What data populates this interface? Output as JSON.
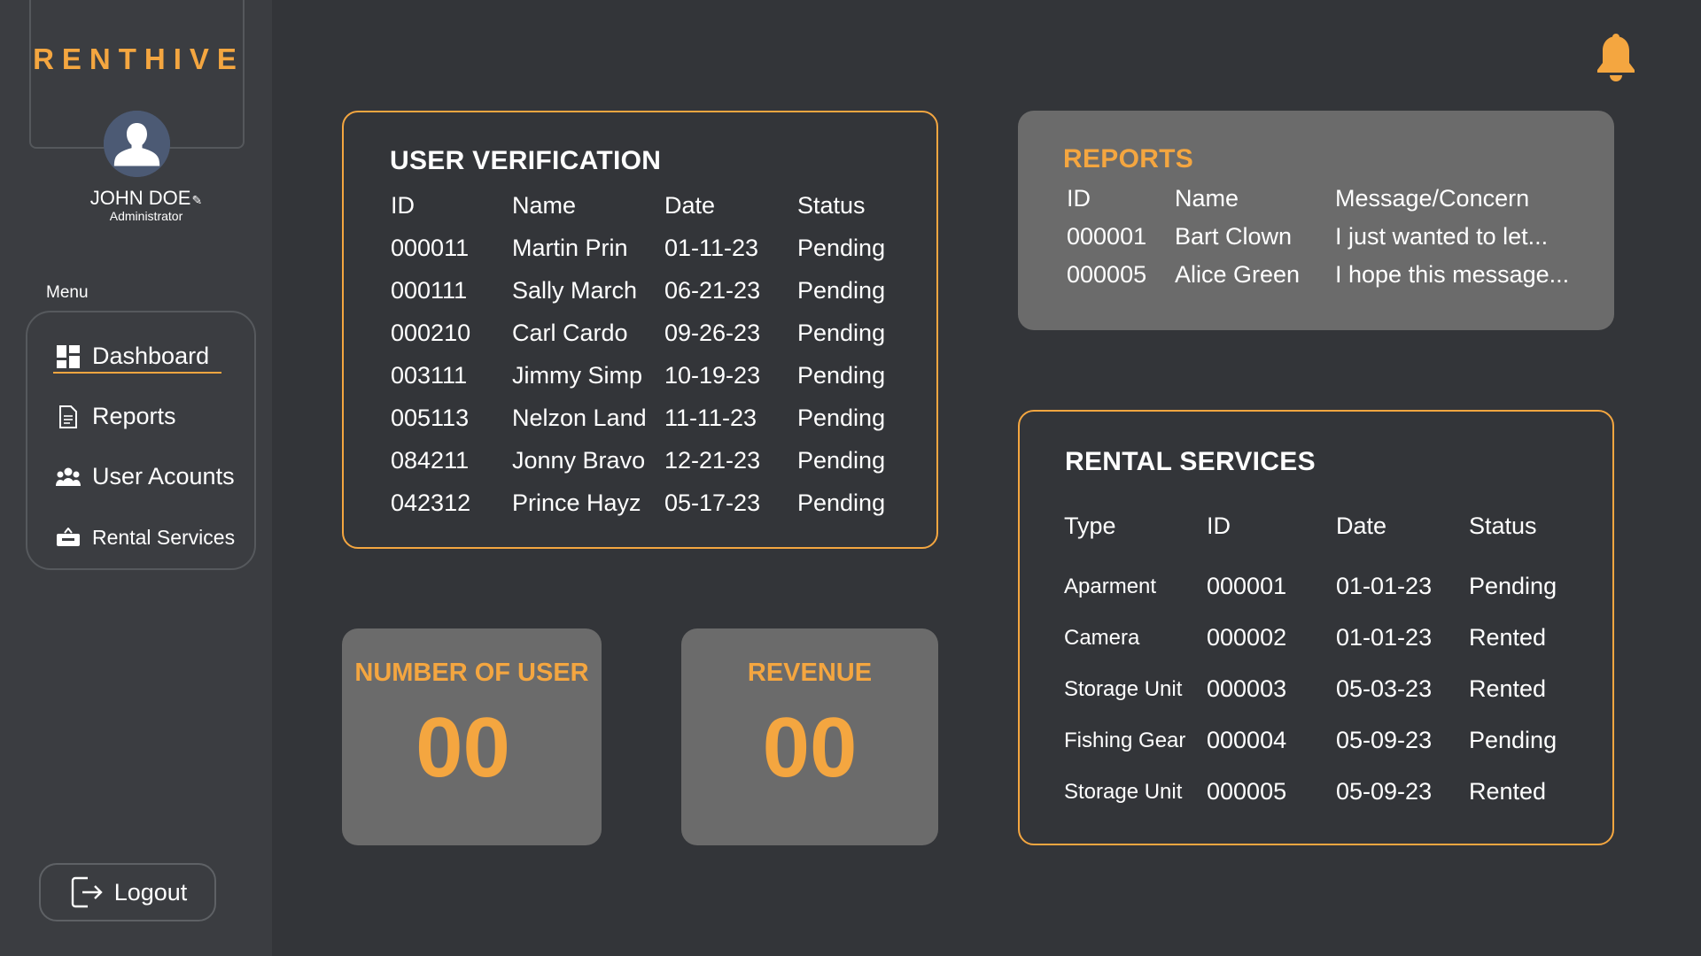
{
  "brand": {
    "name": "RENTHIVE",
    "accent": "#f4a640"
  },
  "user": {
    "name": "JOHN DOE",
    "edit_icon": "pencil-icon",
    "role": "Administrator"
  },
  "menu": {
    "label": "Menu",
    "items": [
      {
        "label": "Dashboard",
        "icon": "dashboard-icon",
        "active": true
      },
      {
        "label": "Reports",
        "icon": "document-icon"
      },
      {
        "label": "User Acounts",
        "icon": "users-icon"
      },
      {
        "label": "Rental Services",
        "icon": "rent-sign-icon"
      }
    ]
  },
  "logout": {
    "label": "Logout",
    "icon": "logout-icon"
  },
  "notifications": {
    "icon": "bell-icon"
  },
  "user_verification": {
    "title": "USER VERIFICATION",
    "columns": [
      "ID",
      "Name",
      "Date",
      "Status"
    ],
    "rows": [
      [
        "000011",
        "Martin Prin",
        "01-11-23",
        "Pending"
      ],
      [
        "000111",
        "Sally March",
        "06-21-23",
        "Pending"
      ],
      [
        "000210",
        "Carl Cardo",
        "09-26-23",
        "Pending"
      ],
      [
        "003111",
        "Jimmy Simp",
        "10-19-23",
        "Pending"
      ],
      [
        "005113",
        "Nelzon Land",
        "11-11-23",
        "Pending"
      ],
      [
        "084211",
        "Jonny Bravo",
        "12-21-23",
        "Pending"
      ],
      [
        "042312",
        "Prince Hayz",
        "05-17-23",
        "Pending"
      ]
    ]
  },
  "reports": {
    "title": "REPORTS",
    "columns": [
      "ID",
      "Name",
      "Message/Concern"
    ],
    "rows": [
      [
        "000001",
        "Bart Clown",
        "I just wanted to let..."
      ],
      [
        "000005",
        "Alice Green",
        "I hope this message..."
      ]
    ]
  },
  "stats": {
    "users": {
      "title": "NUMBER OF USER",
      "value": "00"
    },
    "revenue": {
      "title": "REVENUE",
      "value": "00"
    }
  },
  "rental_services": {
    "title": "RENTAL SERVICES",
    "columns": [
      "Type",
      "ID",
      "Date",
      "Status"
    ],
    "rows": [
      [
        "Aparment",
        "000001",
        "01-01-23",
        "Pending"
      ],
      [
        "Camera",
        "000002",
        "01-01-23",
        "Rented"
      ],
      [
        "Storage Unit",
        "000003",
        "05-03-23",
        "Rented"
      ],
      [
        "Fishing Gear",
        "000004",
        "05-09-23",
        "Pending"
      ],
      [
        "Storage Unit",
        "000005",
        "05-09-23",
        "Rented"
      ]
    ]
  }
}
